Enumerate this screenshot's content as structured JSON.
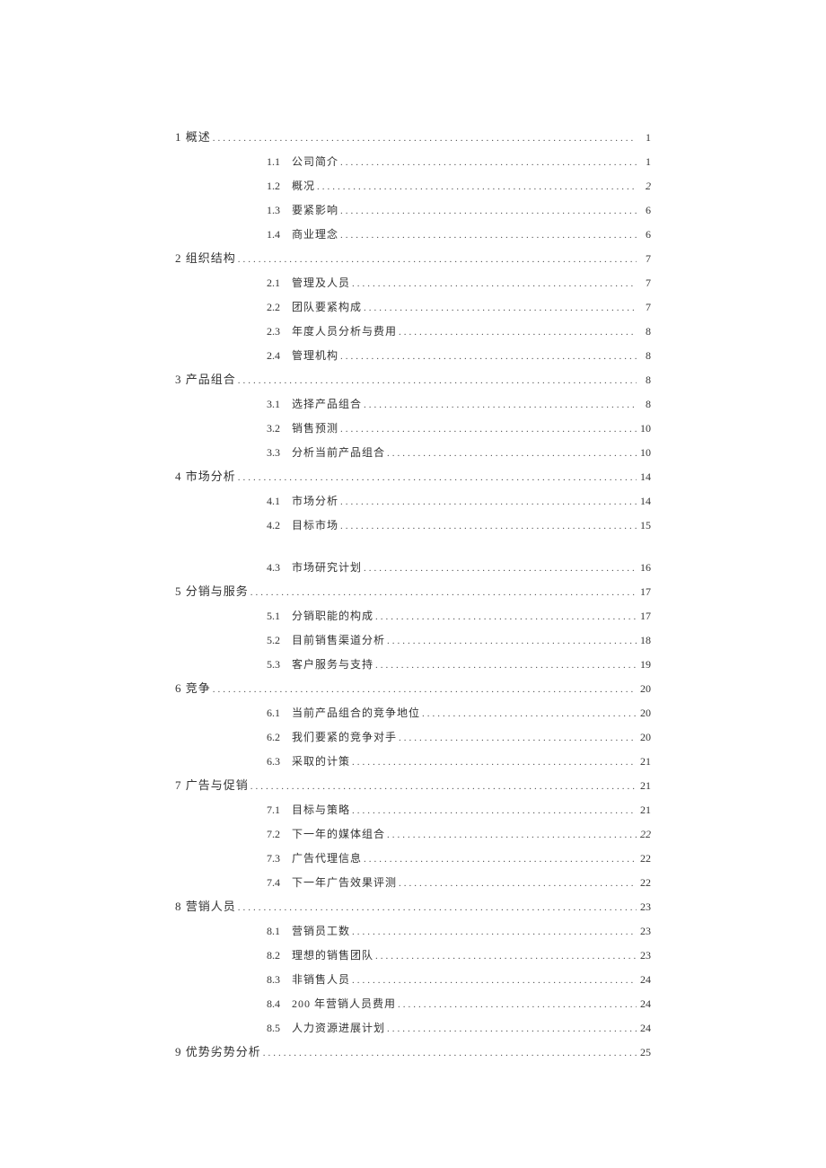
{
  "toc": [
    {
      "level": 1,
      "num": "1 概述",
      "title": "",
      "page": "1",
      "space_after": false
    },
    {
      "level": 2,
      "num": "1.1",
      "title": "公司简介",
      "page": "1"
    },
    {
      "level": 2,
      "num": "1.2",
      "title": "概况",
      "page": "2",
      "italic_page": true
    },
    {
      "level": 2,
      "num": "1.3",
      "title": "要紧影响",
      "page": "6"
    },
    {
      "level": 2,
      "num": "1.4",
      "title": "商业理念",
      "page": "6"
    },
    {
      "level": 1,
      "num": "2 组织结构",
      "title": "",
      "page": "7"
    },
    {
      "level": 2,
      "num": "2.1",
      "title": "管理及人员",
      "page": "7"
    },
    {
      "level": 2,
      "num": "2.2",
      "title": "团队要紧构成",
      "page": "7"
    },
    {
      "level": 2,
      "num": "2.3",
      "title": "年度人员分析与费用",
      "page": "8"
    },
    {
      "level": 2,
      "num": "2.4",
      "title": "管理机构",
      "page": "8"
    },
    {
      "level": 1,
      "num": "3 产品组合",
      "title": "",
      "page": "8"
    },
    {
      "level": 2,
      "num": "3.1",
      "title": "选择产品组合",
      "page": "8"
    },
    {
      "level": 2,
      "num": "3.2",
      "title": "销售预测",
      "page": "10"
    },
    {
      "level": 2,
      "num": "3.3",
      "title": "分析当前产品组合",
      "page": "10"
    },
    {
      "level": 1,
      "num": "4 市场分析",
      "title": "",
      "page": "14"
    },
    {
      "level": 2,
      "num": "4.1",
      "title": "市场分析",
      "page": "14"
    },
    {
      "level": 2,
      "num": "4.2",
      "title": "目标市场",
      "page": "15",
      "space_after": true
    },
    {
      "level": 2,
      "num": "4.3",
      "title": "市场研究计划",
      "page": "16"
    },
    {
      "level": 1,
      "num": "5 分销与服务",
      "title": "",
      "page": "17"
    },
    {
      "level": 2,
      "num": "5.1",
      "title": "分销职能的构成",
      "page": "17"
    },
    {
      "level": 2,
      "num": "5.2",
      "title": "目前销售渠道分析",
      "page": "18"
    },
    {
      "level": 2,
      "num": "5.3",
      "title": "客户服务与支持",
      "page": "19"
    },
    {
      "level": 1,
      "num": "6 竞争",
      "title": "",
      "page": "20"
    },
    {
      "level": 2,
      "num": "6.1",
      "title": "当前产品组合的竞争地位",
      "page": "20"
    },
    {
      "level": 2,
      "num": "6.2",
      "title": "我们要紧的竞争对手",
      "page": "20"
    },
    {
      "level": 2,
      "num": "6.3",
      "title": "采取的计策",
      "page": "21"
    },
    {
      "level": 1,
      "num": "7 广告与促销",
      "title": "",
      "page": "21"
    },
    {
      "level": 2,
      "num": "7.1",
      "title": "目标与策略",
      "page": "21"
    },
    {
      "level": 2,
      "num": "7.2",
      "title": "下一年的媒体组合",
      "page": "22",
      "italic_page": true
    },
    {
      "level": 2,
      "num": "7.3",
      "title": "广告代理信息",
      "page": "22"
    },
    {
      "level": 2,
      "num": "7.4",
      "title": "下一年广告效果评测",
      "page": "22"
    },
    {
      "level": 1,
      "num": "8 营销人员",
      "title": "",
      "page": "23"
    },
    {
      "level": 2,
      "num": "8.1",
      "title": "营销员工数",
      "page": "23"
    },
    {
      "level": 2,
      "num": "8.2",
      "title": "理想的销售团队",
      "page": "23"
    },
    {
      "level": 2,
      "num": "8.3",
      "title": "非销售人员",
      "page": "24"
    },
    {
      "level": 2,
      "num": "8.4",
      "title": "200 年营销人员费用",
      "page": "24"
    },
    {
      "level": 2,
      "num": "8.5",
      "title": "人力资源进展计划",
      "page": "24"
    },
    {
      "level": 1,
      "num": "9 优势劣势分析",
      "title": "",
      "page": "25"
    }
  ]
}
